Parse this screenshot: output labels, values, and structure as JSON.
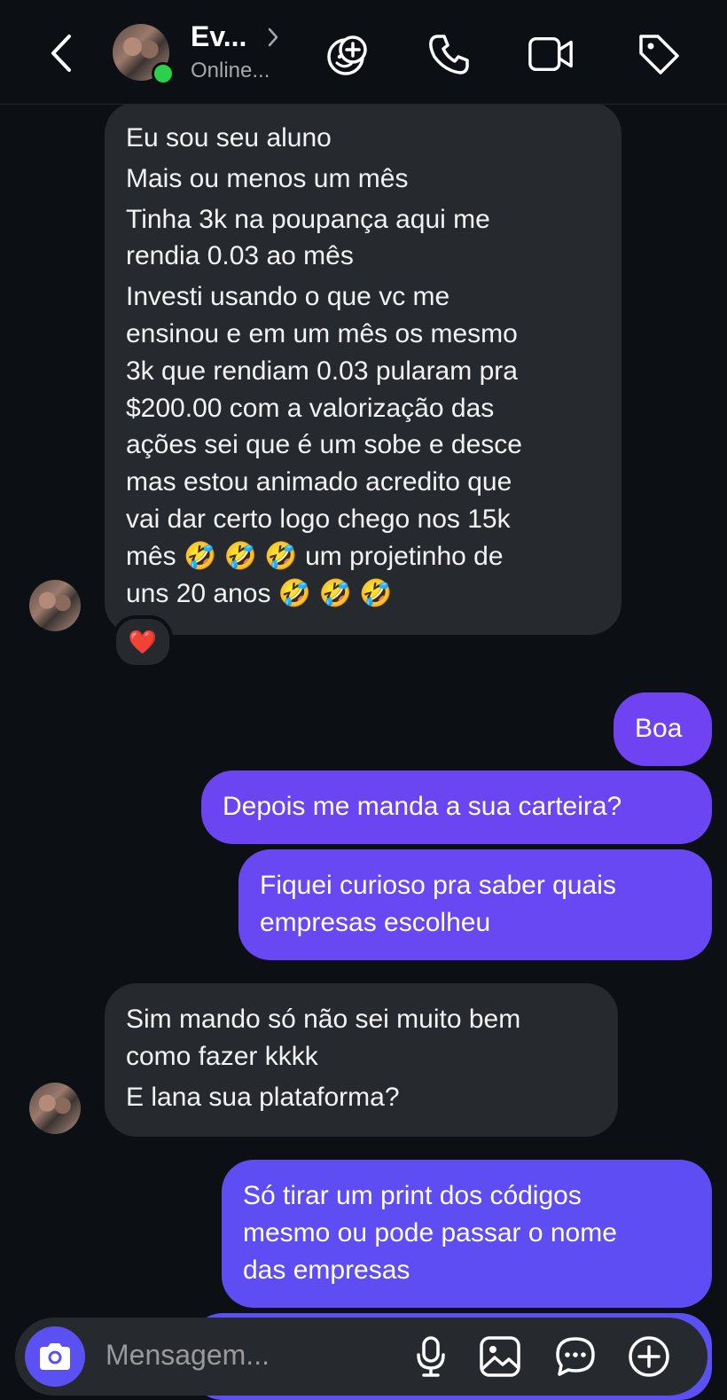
{
  "header": {
    "contact_name": "Ev...",
    "status": "Online...",
    "icons": [
      "back-arrow-icon",
      "avatar",
      "chevron-right-icon",
      "effects-icon",
      "phone-icon",
      "video-icon",
      "tag-icon"
    ]
  },
  "messages": [
    {
      "direction": "incoming",
      "lines": [
        "Eu sou seu aluno",
        "Mais ou menos um mês",
        "Tinha 3k na poupança aqui me",
        "rendia 0.03 ao mês",
        "Investi usando o que vc me",
        "ensinou e em um mês os mesmo",
        "3k que rendiam 0.03 pularam pra",
        "$200.00 com a valorização das",
        "ações sei que é um sobe e desce",
        "mas estou animado acredito que",
        "vai dar certo logo chego nos 15k",
        "mês 🤣 🤣 🤣 um projetinho de",
        "uns 20 anos 🤣 🤣 🤣"
      ],
      "reaction": "❤️"
    },
    {
      "direction": "outgoing",
      "lines": [
        "Boa"
      ]
    },
    {
      "direction": "outgoing",
      "lines": [
        "Depois me manda a sua carteira?"
      ]
    },
    {
      "direction": "outgoing",
      "lines": [
        "Fiquei curioso pra saber quais",
        "empresas escolheu"
      ]
    },
    {
      "direction": "incoming",
      "lines": [
        "Sim mando só não sei muito bem",
        "como fazer kkkk",
        "E lana sua plataforma?"
      ]
    },
    {
      "direction": "outgoing",
      "lines": [
        "Só tirar um print dos códigos",
        "mesmo ou pode passar o nome",
        "das empresas"
      ]
    }
  ],
  "composer": {
    "placeholder": "Mensagem...",
    "icons": [
      "camera-icon",
      "microphone-icon",
      "gallery-icon",
      "sticker-icon",
      "add-icon"
    ]
  },
  "colors": {
    "background": "#0c1014",
    "incoming_bubble": "#262a2f",
    "outgoing_gradient": [
      "#7d3cf0",
      "#5b51f3"
    ],
    "online": "#2bd14b",
    "camera_button": "#5b51f3"
  }
}
